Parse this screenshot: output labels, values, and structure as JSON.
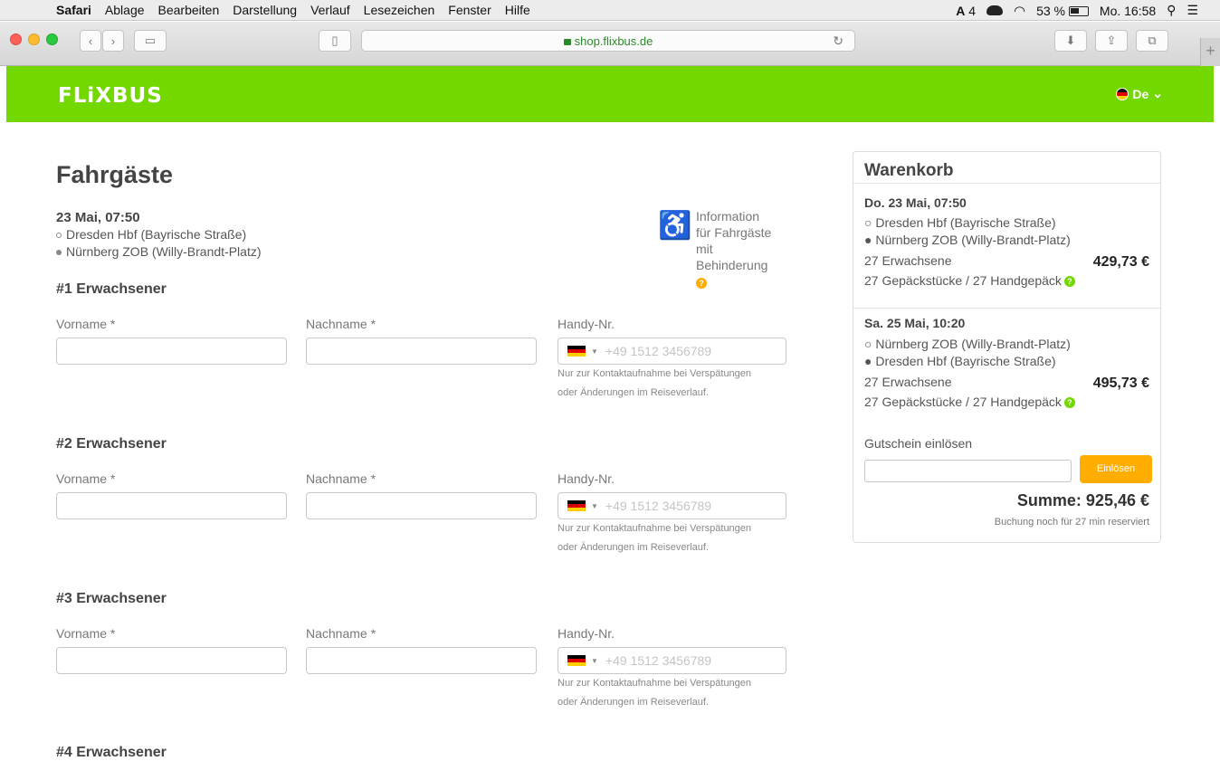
{
  "menubar": {
    "items": [
      "Safari",
      "Ablage",
      "Bearbeiten",
      "Darstellung",
      "Verlauf",
      "Lesezeichen",
      "Fenster",
      "Hilfe"
    ],
    "adobe_count": "4",
    "battery": "53 %",
    "clock": "Mo. 16:58"
  },
  "browser": {
    "url": "shop.flixbus.de"
  },
  "site": {
    "logo": "FLiXBUS",
    "language": "De",
    "brand_color": "#73d700",
    "accent_color": "#ffad00"
  },
  "form": {
    "title": "Fahrgäste",
    "trip": {
      "date": "23 Mai, 07:50",
      "from": "Dresden Hbf (Bayrische Straße)",
      "to": "Nürnberg ZOB (Willy-Brandt-Platz)"
    },
    "accessibility": {
      "lines": [
        "Information",
        "für Fahrgäste",
        "mit",
        "Behinderung"
      ]
    },
    "labels": {
      "firstname": "Vorname *",
      "lastname": "Nachname *",
      "phone": "Handy-Nr.",
      "phone_placeholder": "+49 1512 3456789",
      "phone_hint_1": "Nur zur Kontaktaufnahme bei Verspätungen",
      "phone_hint_2": "oder Änderungen im Reiseverlauf."
    },
    "passengers": [
      {
        "title": "#1 Erwachsener"
      },
      {
        "title": "#2 Erwachsener"
      },
      {
        "title": "#3 Erwachsener"
      },
      {
        "title": "#4 Erwachsener"
      }
    ]
  },
  "cart": {
    "title": "Warenkorb",
    "segments": [
      {
        "date": "Do. 23 Mai, 07:50",
        "from": "Dresden Hbf (Bayrische Straße)",
        "to": "Nürnberg ZOB (Willy-Brandt-Platz)",
        "passengers": "27 Erwachsene",
        "price": "429,73 €",
        "luggage": "27 Gepäckstücke / 27 Handgepäck"
      },
      {
        "date": "Sa. 25 Mai, 10:20",
        "from": "Nürnberg ZOB (Willy-Brandt-Platz)",
        "to": "Dresden Hbf (Bayrische Straße)",
        "passengers": "27 Erwachsene",
        "price": "495,73 €",
        "luggage": "27 Gepäckstücke / 27 Handgepäck"
      }
    ],
    "voucher_label": "Gutschein einlösen",
    "voucher_button": "Einlösen",
    "total": "Summe: 925,46 €",
    "reserved": "Buchung noch für 27 min reserviert"
  }
}
